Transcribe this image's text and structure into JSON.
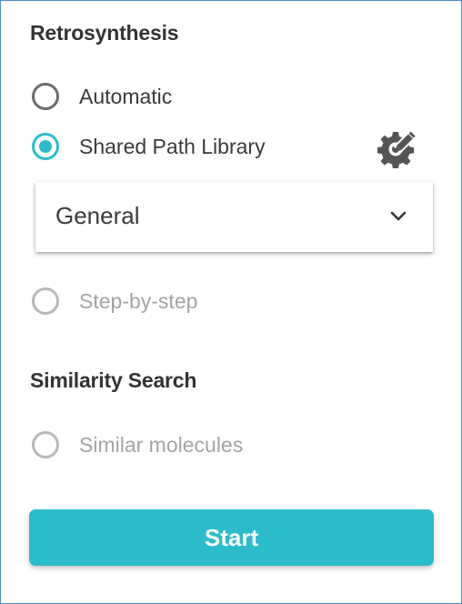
{
  "retrosynthesis": {
    "title": "Retrosynthesis",
    "options": [
      {
        "label": "Automatic",
        "checked": false,
        "disabled": false
      },
      {
        "label": "Shared Path Library",
        "checked": true,
        "disabled": false
      },
      {
        "label": "Step-by-step",
        "checked": false,
        "disabled": true
      }
    ],
    "settings_icon": "gear-edit-icon",
    "library_select": {
      "selected": "General",
      "icon": "chevron-down-icon"
    }
  },
  "similarity": {
    "title": "Similarity Search",
    "options": [
      {
        "label": "Similar molecules",
        "checked": false,
        "disabled": true
      }
    ]
  },
  "start_button": {
    "label": "Start"
  },
  "colors": {
    "accent": "#2bbccb",
    "text": "#3a3a3a",
    "disabled_text": "#a3a3a3",
    "border": "#4a8fc8"
  }
}
